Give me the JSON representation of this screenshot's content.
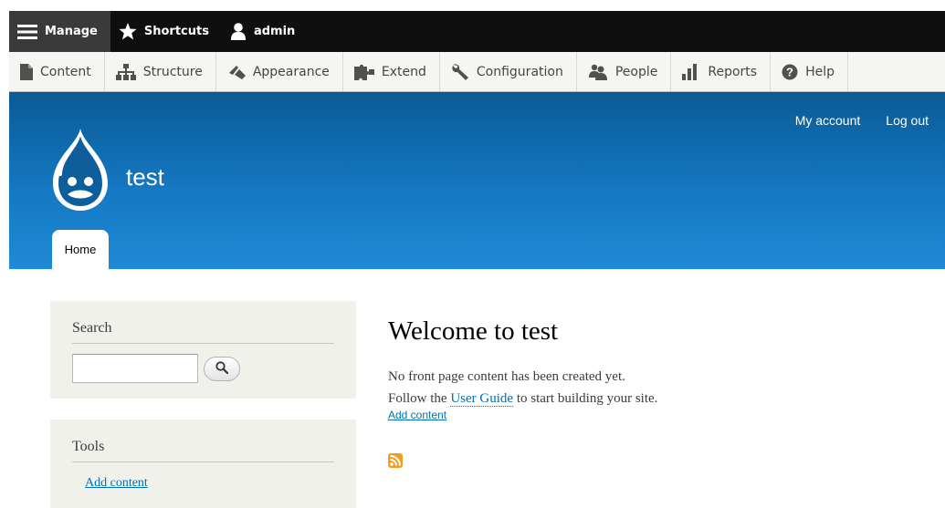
{
  "toolbar": {
    "tabs": [
      {
        "label": "Manage",
        "icon": "hamburger-icon"
      },
      {
        "label": "Shortcuts",
        "icon": "star-icon"
      },
      {
        "label": "admin",
        "icon": "user-icon"
      }
    ],
    "tray": [
      {
        "label": "Content",
        "icon": "document-icon"
      },
      {
        "label": "Structure",
        "icon": "structure-icon"
      },
      {
        "label": "Appearance",
        "icon": "paintbrush-icon"
      },
      {
        "label": "Extend",
        "icon": "puzzle-icon"
      },
      {
        "label": "Configuration",
        "icon": "wrench-icon"
      },
      {
        "label": "People",
        "icon": "people-icon"
      },
      {
        "label": "Reports",
        "icon": "bar-chart-icon"
      },
      {
        "label": "Help",
        "icon": "help-icon"
      }
    ]
  },
  "header": {
    "site_name": "test",
    "secondary_menu": [
      "My account",
      "Log out"
    ],
    "primary_tab": "Home",
    "logo_icon": "drupal-drop-icon"
  },
  "sidebar": {
    "search": {
      "title": "Search",
      "input_value": "",
      "button_icon": "magnifier-icon"
    },
    "tools": {
      "title": "Tools",
      "link": "Add content"
    }
  },
  "main": {
    "title": "Welcome to test",
    "line1": "No front page content has been created yet.",
    "line2_before": "Follow the ",
    "line2_link": "User Guide",
    "line2_after": " to start building your site.",
    "action_link": "Add content",
    "feed_icon": "rss-feed-icon"
  },
  "colors": {
    "toolbar_bg": "#0f0f0f",
    "tray_bg": "#f5f5f2",
    "header_top": "#0b5a96",
    "header_bottom": "#1f8ad6",
    "link": "#0071b3",
    "sidebar_bg": "#f1f1ec",
    "rss": "#f39c1f"
  }
}
